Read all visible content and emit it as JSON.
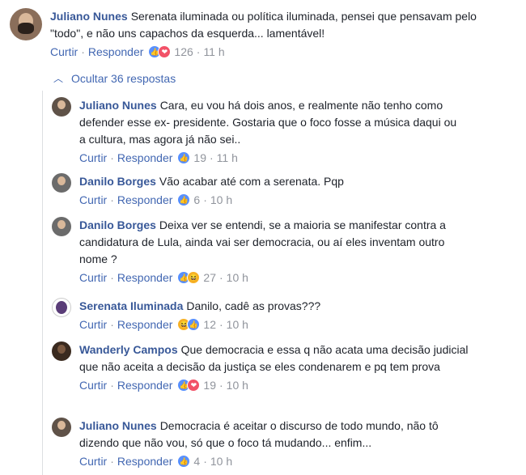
{
  "main": {
    "name": "Juliano Nunes",
    "text": "Serenata iluminada ou política iluminada, pensei que pensavam pelo \"todo\", e não uns capachos da esquerda... lamentável!",
    "like_label": "Curtir",
    "reply_label": "Responder",
    "reactions": [
      "like",
      "love"
    ],
    "count": "126",
    "time": "11 h"
  },
  "toggle": {
    "label": "Ocultar 36 respostas"
  },
  "replies": [
    {
      "name": "Juliano Nunes",
      "text": "Cara, eu vou há dois anos, e realmente não tenho como defender esse ex- presidente. Gostaria que o foco fosse a música daqui ou a cultura, mas agora já não sei..",
      "like_label": "Curtir",
      "reply_label": "Responder",
      "count": "19",
      "time": "11 h"
    },
    {
      "name": "Danilo Borges",
      "text": "Vão acabar até com a serenata. Pqp",
      "like_label": "Curtir",
      "reply_label": "Responder",
      "count": "6",
      "time": "10 h"
    },
    {
      "name": "Danilo Borges",
      "text": "Deixa ver se entendi, se a maioria se manifestar contra a candidatura de Lula, ainda vai ser democracia, ou aí eles inventam outro nome ?",
      "like_label": "Curtir",
      "reply_label": "Responder",
      "count": "27",
      "time": "10 h"
    },
    {
      "name": "Serenata Iluminada",
      "text": "Danilo, cadê as provas???",
      "like_label": "Curtir",
      "reply_label": "Responder",
      "count": "12",
      "time": "10 h"
    },
    {
      "name": "Wanderly Campos",
      "text": "Que democracia e essa q não acata uma decisão judicial que não aceita a decisão da justiça se eles condenarem e pq tem prova",
      "like_label": "Curtir",
      "reply_label": "Responder",
      "count": "19",
      "time": "10 h"
    },
    {
      "name": "Juliano Nunes",
      "text": "Democracia é aceitar o discurso de todo mundo, não tô dizendo que não vou, só que o foco tá mudando... enfim...",
      "like_label": "Curtir",
      "reply_label": "Responder",
      "count": "4",
      "time": "10 h"
    }
  ],
  "colors": {
    "link": "#4267b2",
    "name": "#385898",
    "meta": "#90949c"
  }
}
